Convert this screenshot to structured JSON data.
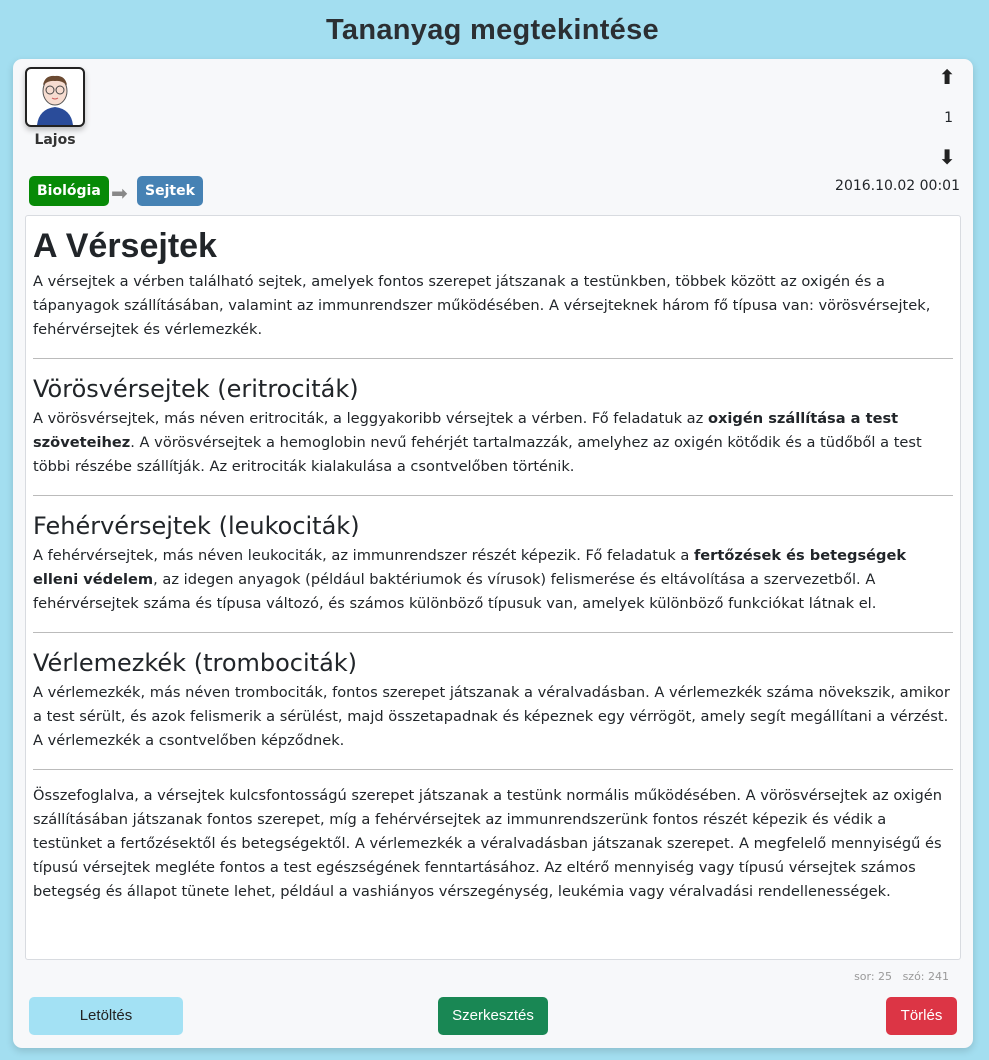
{
  "header": {
    "title": "Tananyag megtekintése"
  },
  "user": {
    "name": "Lajos"
  },
  "breadcrumb": {
    "subject": "Biológia",
    "topic": "Sejtek"
  },
  "order": {
    "value": "1"
  },
  "date": "2016.10.02 00:01",
  "article": {
    "title": "A Vérsejtek",
    "intro": "A vérsejtek a vérben található sejtek, amelyek fontos szerepet játszanak a testünkben, többek között az oxigén és a tápanyagok szállításában, valamint az immunrendszer működésében. A vérsejteknek három fő típusa van: vörösvérsejtek, fehérvérsejtek és vérlemezkék.",
    "sections": [
      {
        "title": "Vörösvérsejtek (eritrociták)",
        "pre": "A vörösvérsejtek, más néven eritrociták, a leggyakoribb vérsejtek a vérben. Fő feladatuk az ",
        "bold": "oxigén szállítása a test szöveteihez",
        "post": ". A vörösvérsejtek a hemoglobin nevű fehérjét tartalmazzák, amelyhez az oxigén kötődik és a tüdőből a test többi részébe szállítják. Az eritrociták kialakulása a csontvelőben történik."
      },
      {
        "title": "Fehérvérsejtek (leukociták)",
        "pre": "A fehérvérsejtek, más néven leukociták, az immunrendszer részét képezik. Fő feladatuk a ",
        "bold": "fertőzések és betegségek elleni védelem",
        "post": ", az idegen anyagok (például baktériumok és vírusok) felismerése és eltávolítása a szervezetből. A fehérvérsejtek száma és típusa változó, és számos különböző típusuk van, amelyek különböző funkciókat látnak el."
      },
      {
        "title": "Vérlemezkék (trombociták)",
        "text": "A vérlemezkék, más néven trombociták, fontos szerepet játszanak a véralvadásban. A vérlemezkék száma növekszik, amikor a test sérült, és azok felismerik a sérülést, majd összetapadnak és képeznek egy vérrögöt, amely segít megállítani a vérzést. A vérlemezkék a csontvelőben képződnek."
      }
    ],
    "summary": "Összefoglalva, a vérsejtek kulcsfontosságú szerepet játszanak a testünk normális működésében. A vörösvérsejtek az oxigén szállításában játszanak fontos szerepet, míg a fehérvérsejtek az immunrendszerünk fontos részét képezik és védik a testünket a fertőzésektől és betegségektől. A vérlemezkék a véralvadásban játszanak szerepet. A megfelelő mennyiségű és típusú vérsejtek megléte fontos a test egészségének fenntartásához. Az eltérő mennyiség vagy típusú vérsejtek számos betegség és állapot tünete lehet, például a vashiányos vérszegénység, leukémia vagy véralvadási rendellenességek."
  },
  "stats": {
    "rows": "sor: 25",
    "words": "szó: 241"
  },
  "buttons": {
    "download": "Letöltés",
    "edit": "Szerkesztés",
    "delete": "Törlés"
  },
  "colors": {
    "subject": "#078a07",
    "topic": "#4682b4",
    "edit": "#198754",
    "delete": "#dc3545",
    "download": "#a3e1f4"
  }
}
